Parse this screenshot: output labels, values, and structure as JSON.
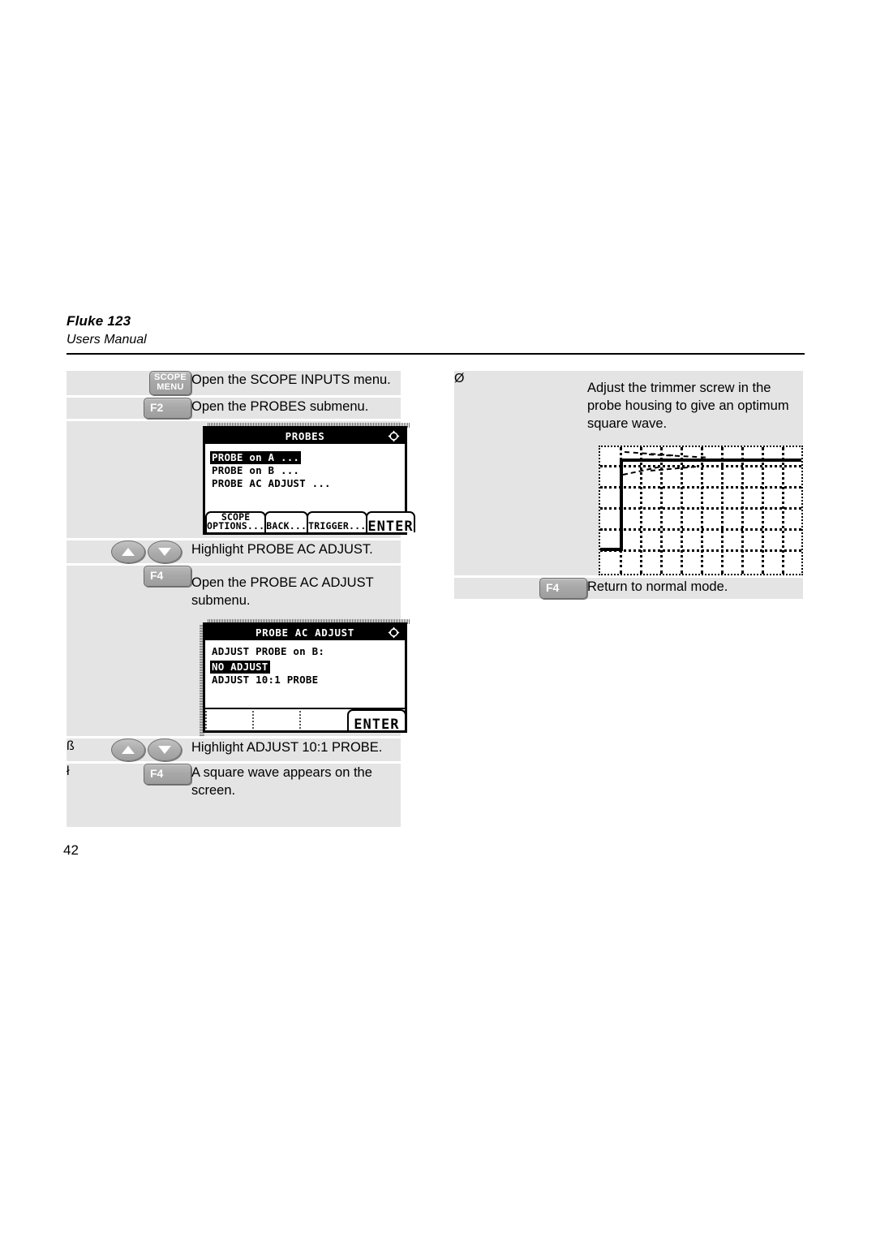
{
  "header": {
    "title": "Fluke 123",
    "subtitle": "Users Manual"
  },
  "page_number": "42",
  "left_table": {
    "rows": [
      {
        "marker": "",
        "key": {
          "type": "scope-menu",
          "line1": "SCOPE",
          "line2": "MENU"
        },
        "text": "Open the SCOPE INPUTS menu."
      },
      {
        "marker": "",
        "key": {
          "type": "fkey",
          "label": "F2"
        },
        "text": "Open the PROBES submenu."
      },
      {
        "marker": "",
        "key": null,
        "text": "",
        "lcd": "probes"
      },
      {
        "marker": "",
        "key": {
          "type": "arrows"
        },
        "text": "Highlight PROBE AC ADJUST."
      },
      {
        "marker": "",
        "key": {
          "type": "fkey",
          "label": "F4"
        },
        "text": "Open the PROBE AC ADJUST submenu.",
        "lcd": "probe_ac_adjust"
      },
      {
        "marker": "ß",
        "key": {
          "type": "arrows"
        },
        "text": "Highlight ADJUST 10:1 PROBE."
      },
      {
        "marker": "ł",
        "key": {
          "type": "fkey",
          "label": "F4"
        },
        "text": "A square wave appears on the screen."
      }
    ]
  },
  "right_table": {
    "rows": [
      {
        "marker": "Ø",
        "key": null,
        "text": "Adjust  the trimmer screw in the probe housing to give an optimum square wave.",
        "waveform": true
      },
      {
        "marker": "",
        "key": {
          "type": "fkey",
          "label": "F4"
        },
        "text": "Return to normal mode."
      }
    ]
  },
  "lcd_screens": {
    "probes": {
      "title": "PROBES",
      "cursor_icon": "four-way-arrow-icon",
      "items": [
        {
          "label": "PROBE on A ...",
          "selected": true
        },
        {
          "label": "PROBE on B ...",
          "selected": false
        },
        {
          "label": "PROBE AC ADJUST ...",
          "selected": false
        }
      ],
      "softkeys": [
        {
          "label": "SCOPE\nOPTIONS...",
          "kind": "normal"
        },
        {
          "label": "BACK...",
          "kind": "normal"
        },
        {
          "label": "TRIGGER...",
          "kind": "normal"
        },
        {
          "label": "ENTER",
          "kind": "enter"
        }
      ]
    },
    "probe_ac_adjust": {
      "title": "PROBE AC ADJUST",
      "cursor_icon": "four-way-arrow-icon",
      "items": [
        {
          "label": "ADJUST PROBE on B:",
          "selected": false
        },
        {
          "label": "NO ADJUST",
          "selected": true
        },
        {
          "label": "ADJUST 10:1 PROBE",
          "selected": false
        }
      ],
      "softkeys": [
        {
          "label": "",
          "kind": "blank"
        },
        {
          "label": "",
          "kind": "blank"
        },
        {
          "label": "",
          "kind": "blank"
        },
        {
          "label": "ENTER",
          "kind": "enter"
        }
      ]
    }
  },
  "waveform": {
    "description": "square wave rising edge with overshoot on oscilloscope grid",
    "columns": 10,
    "rows": 6
  },
  "colors": {
    "row_background": "#e4e4e4",
    "page_background": "#ffffff",
    "key_face": "#a8a8a8",
    "text": "#000000"
  }
}
